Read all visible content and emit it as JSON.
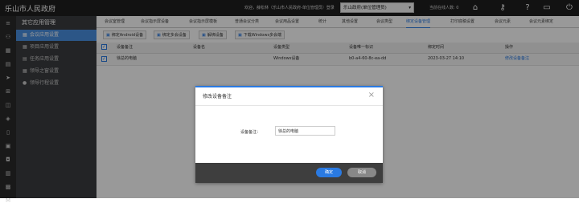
{
  "header": {
    "app_title": "乐山市人民政府",
    "welcome": "欢迎，薛松林（乐山市人民政府-单位管理员）登录",
    "unit_select": "乐山政府(单位管理员)",
    "online": "当前在线人数: 0"
  },
  "sidebar": {
    "title": "其它应用管理",
    "items": [
      {
        "label": "会议应用设置",
        "icon": "grid-icon"
      },
      {
        "label": "项目应用设置",
        "icon": "grid-icon"
      },
      {
        "label": "任务应用设置",
        "icon": "list-icon"
      },
      {
        "label": "领导之窗设置",
        "icon": "grid-icon"
      },
      {
        "label": "领导行程设置",
        "icon": "person-icon"
      }
    ]
  },
  "tabs": [
    "会议室管理",
    "会议指示屏设备",
    "会议指示屏模板",
    "普通会议分类",
    "会议用品设置",
    "统计",
    "其他设置",
    "会议类型",
    "绑定设备管理",
    "打印底稿设置",
    "会议元素",
    "会议元素绑定"
  ],
  "toolbar": {
    "btn1": "绑定Android设备",
    "btn2": "绑定多会设备",
    "btn3": "解绑设备",
    "btn4": "下载Windows多会端"
  },
  "table": {
    "headers": [
      "设备备注",
      "设备名",
      "设备类型",
      "设备唯一标识",
      "绑定时间",
      "操作"
    ],
    "rows": [
      {
        "note": "徐总的电脑",
        "name": "",
        "type": "Windows设备",
        "id": "b0-a4-60-8c-ea-dd",
        "time": "2023-03-27 14:10",
        "action": "修改设备备注"
      }
    ]
  },
  "dialog": {
    "title": "修改设备备注",
    "field_label": "设备备注：",
    "field_value": "徐总的电脑",
    "ok": "确定",
    "cancel": "取消"
  }
}
